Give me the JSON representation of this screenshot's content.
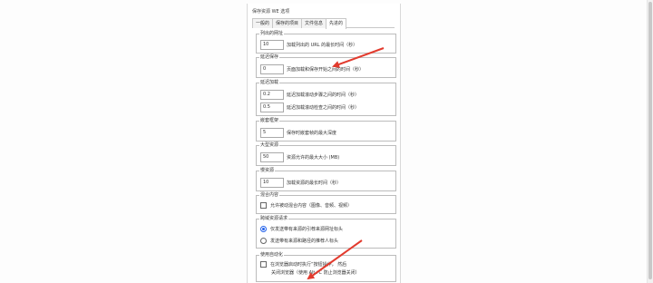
{
  "title": "保存资源 WE 选项",
  "tabs": [
    "一般的",
    "保存的项目",
    "文件信息",
    "先进的"
  ],
  "groups": {
    "listed_urls": {
      "label": "列出的网址",
      "value": "10",
      "desc": "加载列出的 URL 的最长时间（秒）"
    },
    "delayed_save": {
      "label": "延迟保存",
      "value": "0",
      "desc": "页面加载和保存开始之间的时间（秒）"
    },
    "delayed_load": {
      "label": "延迟加载",
      "rows": [
        {
          "value": "0.2",
          "desc": "延迟加载滚动步骤之间的时间（秒）"
        },
        {
          "value": "0.5",
          "desc": "延迟加载滚动检查之间的时间（秒）"
        }
      ]
    },
    "nested_frames": {
      "label": "嵌套框架",
      "value": "5",
      "desc": "保存时嵌套帧的最大深度"
    },
    "large_resources": {
      "label": "大型资源",
      "value": "50",
      "desc": "资源允许的最大大小 (MB)"
    },
    "slow_resources": {
      "label": "慢资源",
      "value": "10",
      "desc": "加载资源的最长时间（秒）"
    },
    "mixed_content": {
      "label": "混合内容",
      "checkbox": "允许被动混合内容（图像、音频、视频）"
    },
    "cross_origin": {
      "label": "跨域资源请求",
      "options": [
        "仅发送带有来源的引荐来源网址标头",
        "发送带有来源和路径的推荐人标头"
      ],
      "selected": 0
    },
    "automation": {
      "label": "使用自动化",
      "line1": "在浏览器启动时执行”按钮操作，   然后",
      "line2": "关闭浏览器（使用 Alt+C 防止浏览器关闭）"
    }
  },
  "colors": {
    "arrow": "#e23b2e",
    "accent": "#2563eb"
  }
}
